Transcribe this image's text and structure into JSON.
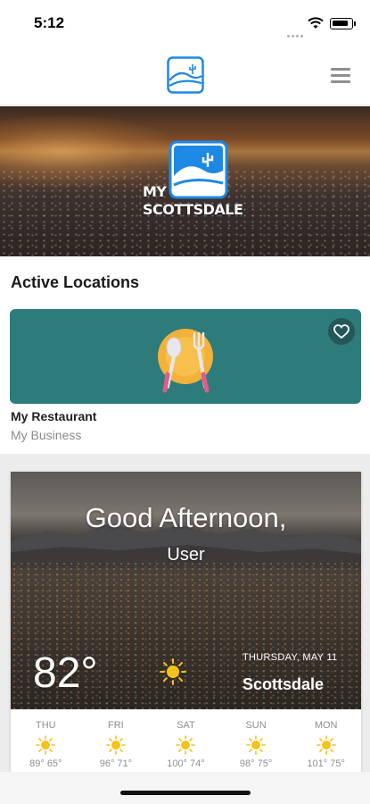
{
  "status_bar": {
    "time": "5:12"
  },
  "header": {
    "logo_icon": "my-scottsdale-logo-icon",
    "menu_icon": "hamburger-menu-icon"
  },
  "hero": {
    "line1": "MY",
    "line2": "SCOTTSDALE",
    "logo_icon": "desert-cactus-logo-icon"
  },
  "active_locations": {
    "title": "Active Locations",
    "items": [
      {
        "name": "My Restaurant",
        "subtitle": "My Business",
        "icon": "plate-spoon-fork-icon",
        "favorite_icon": "heart-icon",
        "card_color": "#2e7b7b"
      }
    ]
  },
  "weather": {
    "greeting": "Good Afternoon,",
    "user": "User",
    "current_temp": "82°",
    "condition_icon": "sun-icon",
    "date": "THURSDAY, MAY 11",
    "city": "Scottsdale",
    "forecast": [
      {
        "day": "THU",
        "temps": "89°  65°",
        "icon": "sun-icon"
      },
      {
        "day": "FRI",
        "temps": "96°  71°",
        "icon": "sun-icon"
      },
      {
        "day": "SAT",
        "temps": "100°  74°",
        "icon": "sun-icon"
      },
      {
        "day": "SUN",
        "temps": "98°  75°",
        "icon": "sun-icon"
      },
      {
        "day": "MON",
        "temps": "101°  75°",
        "icon": "sun-icon"
      }
    ]
  },
  "colors": {
    "brand_blue": "#1e88e5",
    "sun_yellow": "#f5c21b"
  }
}
